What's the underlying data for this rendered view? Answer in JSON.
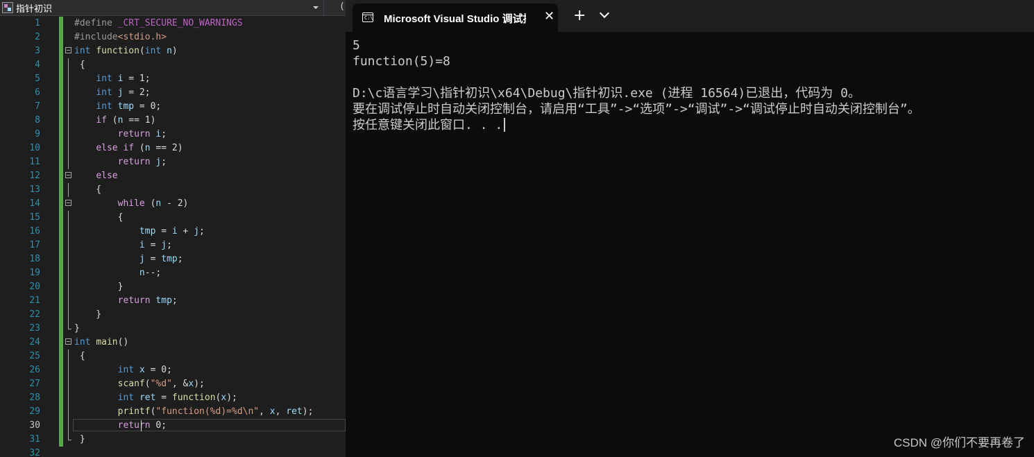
{
  "editor": {
    "nav_title": "指针初识",
    "nav_second": "(",
    "current_line": 30,
    "lines": [
      {
        "num": "1",
        "tokens": [
          {
            "t": "#define ",
            "c": "pp"
          },
          {
            "t": "_CRT_SECURE_NO_WARNINGS",
            "c": "mac"
          }
        ]
      },
      {
        "num": "2",
        "tokens": [
          {
            "t": "#include",
            "c": "pp"
          },
          {
            "t": "<stdio.h>",
            "c": "str"
          }
        ]
      },
      {
        "num": "3",
        "tokens": [
          {
            "t": "int",
            "c": "kw"
          },
          {
            "t": " "
          },
          {
            "t": "function",
            "c": "fn"
          },
          {
            "t": "("
          },
          {
            "t": "int",
            "c": "kw"
          },
          {
            "t": " "
          },
          {
            "t": "n",
            "c": "var"
          },
          {
            "t": ")"
          }
        ]
      },
      {
        "num": "4",
        "tokens": [
          {
            "t": " {"
          }
        ]
      },
      {
        "num": "5",
        "tokens": [
          {
            "t": "    "
          },
          {
            "t": "int",
            "c": "kw"
          },
          {
            "t": " "
          },
          {
            "t": "i",
            "c": "var"
          },
          {
            "t": " = 1;"
          }
        ]
      },
      {
        "num": "6",
        "tokens": [
          {
            "t": "    "
          },
          {
            "t": "int",
            "c": "kw"
          },
          {
            "t": " "
          },
          {
            "t": "j",
            "c": "var"
          },
          {
            "t": " = 2;"
          }
        ]
      },
      {
        "num": "7",
        "tokens": [
          {
            "t": "    "
          },
          {
            "t": "int",
            "c": "kw"
          },
          {
            "t": " "
          },
          {
            "t": "tmp",
            "c": "var"
          },
          {
            "t": " = 0;"
          }
        ]
      },
      {
        "num": "8",
        "tokens": [
          {
            "t": "    "
          },
          {
            "t": "if",
            "c": "ctl"
          },
          {
            "t": " ("
          },
          {
            "t": "n",
            "c": "var"
          },
          {
            "t": " == 1)"
          }
        ]
      },
      {
        "num": "9",
        "tokens": [
          {
            "t": "        "
          },
          {
            "t": "return",
            "c": "ctl"
          },
          {
            "t": " "
          },
          {
            "t": "i",
            "c": "var"
          },
          {
            "t": ";"
          }
        ]
      },
      {
        "num": "10",
        "tokens": [
          {
            "t": "    "
          },
          {
            "t": "else",
            "c": "ctl"
          },
          {
            "t": " "
          },
          {
            "t": "if",
            "c": "ctl"
          },
          {
            "t": " ("
          },
          {
            "t": "n",
            "c": "var"
          },
          {
            "t": " == 2)"
          }
        ]
      },
      {
        "num": "11",
        "tokens": [
          {
            "t": "        "
          },
          {
            "t": "return",
            "c": "ctl"
          },
          {
            "t": " "
          },
          {
            "t": "j",
            "c": "var"
          },
          {
            "t": ";"
          }
        ]
      },
      {
        "num": "12",
        "tokens": [
          {
            "t": "    "
          },
          {
            "t": "else",
            "c": "ctl"
          }
        ]
      },
      {
        "num": "13",
        "tokens": [
          {
            "t": "    {"
          }
        ]
      },
      {
        "num": "14",
        "tokens": [
          {
            "t": "        "
          },
          {
            "t": "while",
            "c": "ctl"
          },
          {
            "t": " ("
          },
          {
            "t": "n",
            "c": "var"
          },
          {
            "t": " - 2)"
          }
        ]
      },
      {
        "num": "15",
        "tokens": [
          {
            "t": "        {"
          }
        ]
      },
      {
        "num": "16",
        "tokens": [
          {
            "t": "            "
          },
          {
            "t": "tmp",
            "c": "var"
          },
          {
            "t": " = "
          },
          {
            "t": "i",
            "c": "var"
          },
          {
            "t": " + "
          },
          {
            "t": "j",
            "c": "var"
          },
          {
            "t": ";"
          }
        ]
      },
      {
        "num": "17",
        "tokens": [
          {
            "t": "            "
          },
          {
            "t": "i",
            "c": "var"
          },
          {
            "t": " = "
          },
          {
            "t": "j",
            "c": "var"
          },
          {
            "t": ";"
          }
        ]
      },
      {
        "num": "18",
        "tokens": [
          {
            "t": "            "
          },
          {
            "t": "j",
            "c": "var"
          },
          {
            "t": " = "
          },
          {
            "t": "tmp",
            "c": "var"
          },
          {
            "t": ";"
          }
        ]
      },
      {
        "num": "19",
        "tokens": [
          {
            "t": "            "
          },
          {
            "t": "n",
            "c": "var"
          },
          {
            "t": "--;"
          }
        ]
      },
      {
        "num": "20",
        "tokens": [
          {
            "t": "        }"
          }
        ]
      },
      {
        "num": "21",
        "tokens": [
          {
            "t": "        "
          },
          {
            "t": "return",
            "c": "ctl"
          },
          {
            "t": " "
          },
          {
            "t": "tmp",
            "c": "var"
          },
          {
            "t": ";"
          }
        ]
      },
      {
        "num": "22",
        "tokens": [
          {
            "t": "    }"
          }
        ]
      },
      {
        "num": "23",
        "tokens": [
          {
            "t": "}"
          }
        ]
      },
      {
        "num": "24",
        "tokens": [
          {
            "t": "int",
            "c": "kw"
          },
          {
            "t": " "
          },
          {
            "t": "main",
            "c": "fn"
          },
          {
            "t": "()"
          }
        ]
      },
      {
        "num": "25",
        "tokens": [
          {
            "t": " {"
          }
        ]
      },
      {
        "num": "26",
        "tokens": [
          {
            "t": "        "
          },
          {
            "t": "int",
            "c": "kw"
          },
          {
            "t": " "
          },
          {
            "t": "x",
            "c": "var"
          },
          {
            "t": " = 0;"
          }
        ]
      },
      {
        "num": "27",
        "tokens": [
          {
            "t": "        "
          },
          {
            "t": "scanf",
            "c": "fn"
          },
          {
            "t": "("
          },
          {
            "t": "\"%d\"",
            "c": "str"
          },
          {
            "t": ", &"
          },
          {
            "t": "x",
            "c": "var"
          },
          {
            "t": ");"
          }
        ]
      },
      {
        "num": "28",
        "tokens": [
          {
            "t": "        "
          },
          {
            "t": "int",
            "c": "kw"
          },
          {
            "t": " "
          },
          {
            "t": "ret",
            "c": "var"
          },
          {
            "t": " = "
          },
          {
            "t": "function",
            "c": "fn"
          },
          {
            "t": "("
          },
          {
            "t": "x",
            "c": "var"
          },
          {
            "t": ");"
          }
        ]
      },
      {
        "num": "29",
        "tokens": [
          {
            "t": "        "
          },
          {
            "t": "printf",
            "c": "fn"
          },
          {
            "t": "("
          },
          {
            "t": "\"function(%d)=%d\\n\"",
            "c": "str"
          },
          {
            "t": ", "
          },
          {
            "t": "x",
            "c": "var"
          },
          {
            "t": ", "
          },
          {
            "t": "ret",
            "c": "var"
          },
          {
            "t": ");"
          }
        ]
      },
      {
        "num": "30",
        "tokens": [
          {
            "t": "        "
          },
          {
            "t": "return",
            "c": "ctl"
          },
          {
            "t": " 0;"
          }
        ]
      },
      {
        "num": "31",
        "tokens": [
          {
            "t": " }"
          }
        ]
      },
      {
        "num": "32",
        "tokens": []
      }
    ]
  },
  "terminal": {
    "tab_title": "Microsoft Visual Studio 调试控制台",
    "tab_icon_text": "C:\\",
    "close_glyph": "✕",
    "add_glyph": "+",
    "output_lines": [
      "5",
      "function(5)=8",
      "",
      "D:\\c语言学习\\指针初识\\x64\\Debug\\指针初识.exe (进程 16564)已退出，代码为 0。",
      "要在调试停止时自动关闭控制台，请启用“工具”->“选项”->“调试”->“调试停止时自动关闭控制台”。",
      "按任意键关闭此窗口. . ."
    ]
  },
  "watermark": "CSDN @你们不要再卷了"
}
